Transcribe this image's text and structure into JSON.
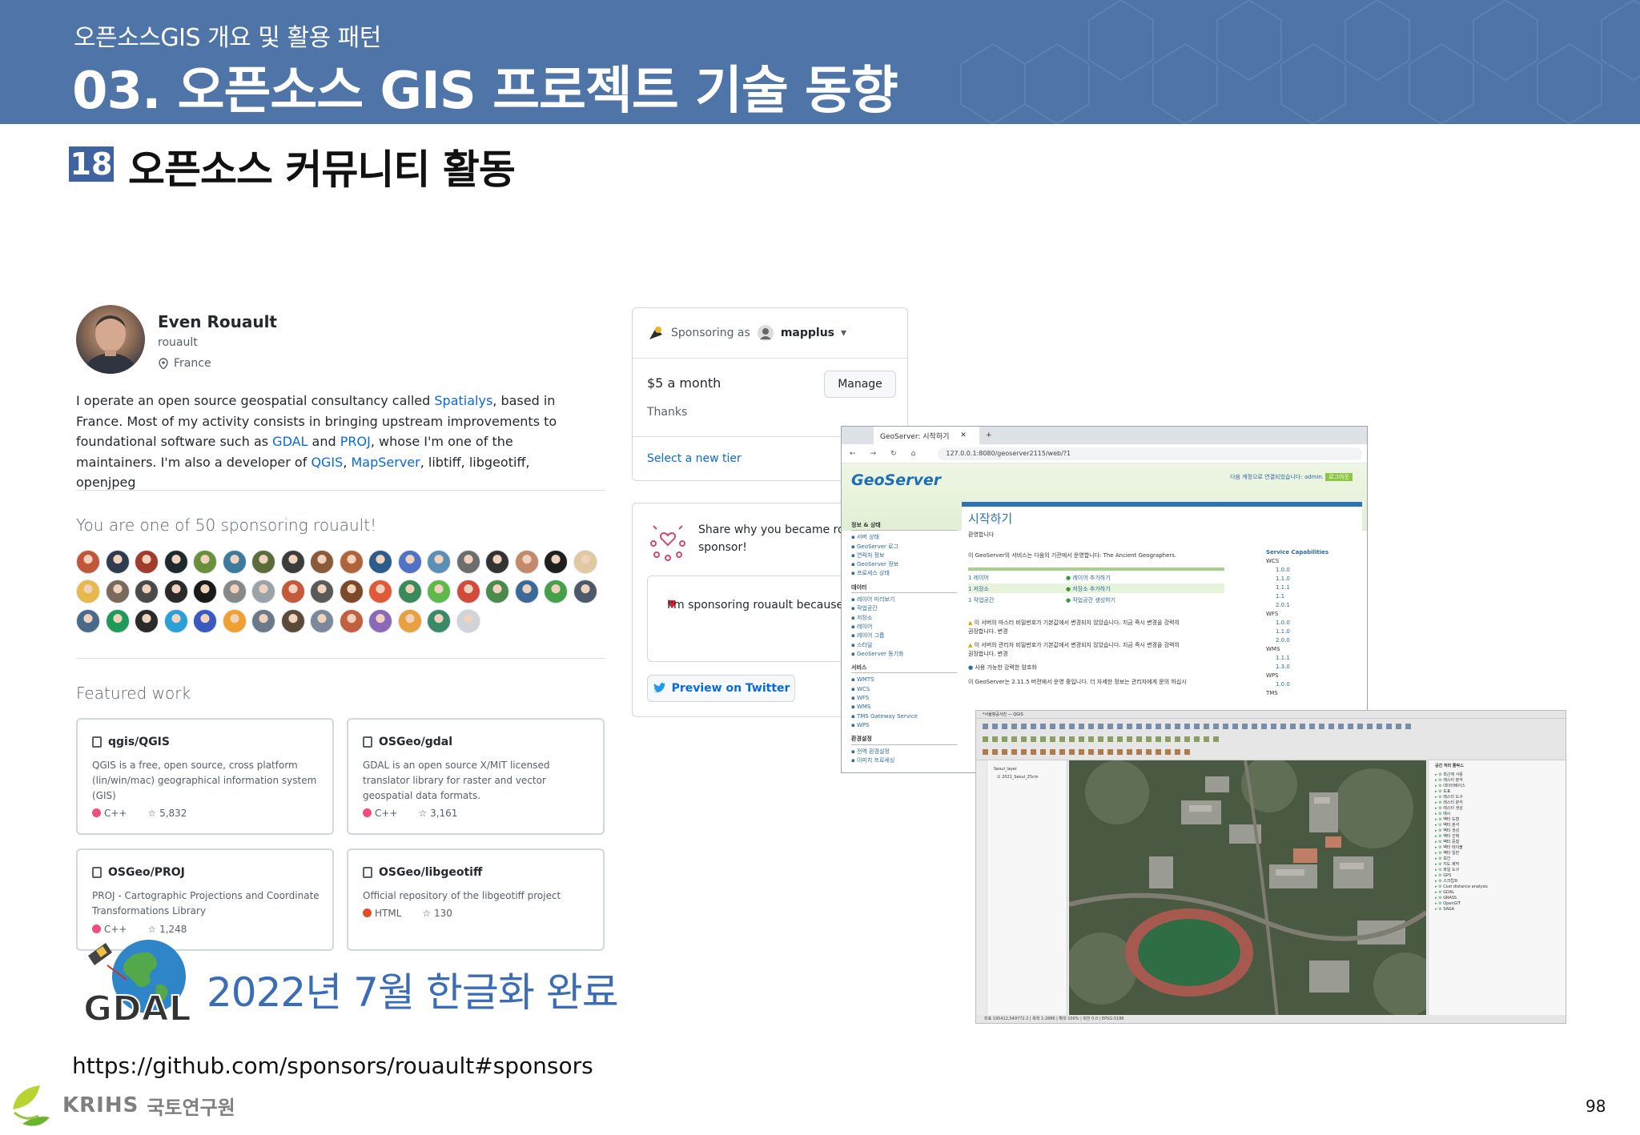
{
  "header": {
    "subtitle": "오픈소스GIS 개요 및 활용 패턴",
    "title": "03. 오픈소스 GIS 프로젝트 기술 동향"
  },
  "section": {
    "number": "18",
    "title": "오픈소스 커뮤니티 활동"
  },
  "profile": {
    "name": "Even Rouault",
    "login": "rouault",
    "location": "France",
    "bio_parts": {
      "p1": "I operate an open source geospatial consultancy called ",
      "spatialys": "Spatialys",
      "p2": ", based in France. Most of my activity consists in bringing upstream improvements to foundational software such as ",
      "gdal": "GDAL",
      "p3": " and ",
      "proj": "PROJ",
      "p4": ", whose I'm one of the maintainers. I'm also a developer of ",
      "qgis": "QGIS",
      "p5": ", ",
      "mapserver": "MapServer",
      "p6": ", libtiff, libgeotiff, openjpeg"
    },
    "sponsoring_count": "You are one of 50 sponsoring rouault!",
    "featured_title": "Featured work"
  },
  "repos": [
    {
      "name": "qgis/QGIS",
      "desc": "QGIS is a free, open source, cross platform (lin/win/mac) geographical information system (GIS)",
      "lang": "C++",
      "lang_color": "#f34b7d",
      "stars": "5,832"
    },
    {
      "name": "OSGeo/gdal",
      "desc": "GDAL is an open source X/MIT licensed translator library for raster and vector geospatial data formats.",
      "lang": "C++",
      "lang_color": "#f34b7d",
      "stars": "3,161"
    },
    {
      "name": "OSGeo/PROJ",
      "desc": "PROJ - Cartographic Projections and Coordinate Transformations Library",
      "lang": "C++",
      "lang_color": "#f34b7d",
      "stars": "1,248"
    },
    {
      "name": "OSGeo/libgeotiff",
      "desc": "Official repository of the libgeotiff project",
      "lang": "HTML",
      "lang_color": "#e34c26",
      "stars": "130"
    }
  ],
  "sponsor_box": {
    "sponsoring_as": "Sponsoring as",
    "user": "mapplus",
    "amount": "$5 a month",
    "thanks": "Thanks",
    "manage": "Manage",
    "select_tier": "Select a new tier"
  },
  "share_box": {
    "text_line1": "Share why you became rou",
    "text_line2": "sponsor!",
    "textarea": "I'm sponsoring rouault because",
    "twitter": "Preview on Twitter"
  },
  "geoserver": {
    "tab": "GeoServer: 시작하기",
    "url": "127.0.0.1:8080/geoserver2115/web/?1",
    "logo": "GeoServer",
    "login": "다음 계정으로 연결되었습니다: admin.",
    "logout": "로그아웃",
    "main_title": "시작하기",
    "welcome": "환영합니다",
    "org_line": "이 GeoServer의 서비스는 다음의 기관에서 운영합니다: The Ancient Geographers.",
    "r1a": "1 레이어",
    "r1b": "레이어 추가하기",
    "r2a": "1 저장소",
    "r2b": "저장소 추가하기",
    "r3a": "1 작업공간",
    "r3b": "작업공간 생성하기",
    "warn1": "이 서버의 마스터 비밀번호가 기본값에서 변경되지 않았습니다. 지금 즉시 변경을 강력히",
    "warn1b": "권장합니다. 변경",
    "warn2": "이 서버의 관리자 비밀번호가 기본값에서 변경되지 않았습니다. 지금 즉시 변경을 강력히",
    "warn2b": "권장합니다. 변경",
    "coverage": "사용 가능한 강력한 암호화",
    "version": "이 GeoServer는 2.11.5 버전에서 운영 중입니다. 더 자세한 정보는 관리자에게 문의 하십시",
    "caps_title": "Service Capabilities",
    "side": {
      "g1": "정보 & 상태",
      "g1_items": [
        "서버 상태",
        "GeoServer 로그",
        "연락처 정보",
        "GeoServer 정보",
        "프로세스 상태"
      ],
      "g2": "데이터",
      "g2_items": [
        "레이어 미리보기",
        "작업공간",
        "저장소",
        "레이어",
        "레이어 그룹",
        "스타일",
        "GeoServer 동기화"
      ],
      "g3": "서비스",
      "g3_items": [
        "WMTS",
        "WCS",
        "WFS",
        "WMS",
        "TMS Gateway Service",
        "WPS"
      ],
      "g4": "환경설정",
      "g4_items": [
        "전역 환경설정",
        "이미지 프로세싱"
      ]
    },
    "caps": [
      "WCS",
      "1.0.0",
      "1.1.0",
      "1.1.1",
      "1.1",
      "2.0.1",
      "WFS",
      "1.0.0",
      "1.1.0",
      "2.0.0",
      "WMS",
      "1.1.1",
      "1.3.0",
      "WPS",
      "1.0.0",
      "TMS"
    ]
  },
  "qgis": {
    "title": "*서울항공사진 — QGIS",
    "layer_group": "Seoul_layer",
    "layer": "2021_Seoul_25cm",
    "panel_title": "공간 처리 툴박스",
    "status": "좌표 195412,549772.2 | 축척 1:2886 | 확대 100% | 회전 0.0 | EPSG:5186",
    "tools": [
      "최근에 사용",
      "래스터 분석",
      "데이터베이스",
      "도표",
      "래스터 도구",
      "래스터 분석",
      "래스터 생성",
      "메시",
      "벡터 도형",
      "벡터 분석",
      "벡터 생성",
      "벡터 선택",
      "벡터 중첩",
      "벡터 테이블",
      "벡터 일반",
      "보간",
      "지도 제작",
      "파일 도구",
      "GPS",
      "스크립트",
      "Cost distance analysis",
      "GDAL",
      "GRASS",
      "OpenGIT",
      "SAGA"
    ]
  },
  "gdal_caption": "2022년 7월 한글화 완료",
  "source_url": "https://github.com/sponsors/rouault#sponsors",
  "logo": {
    "latin": "KRIHS",
    "korean": "국토연구원"
  },
  "page_number": "98",
  "colors": {
    "header_bg": "#4f75a8",
    "section_badge": "#3f63a0",
    "link": "#0969da",
    "caption_blue": "#3a6db5"
  }
}
